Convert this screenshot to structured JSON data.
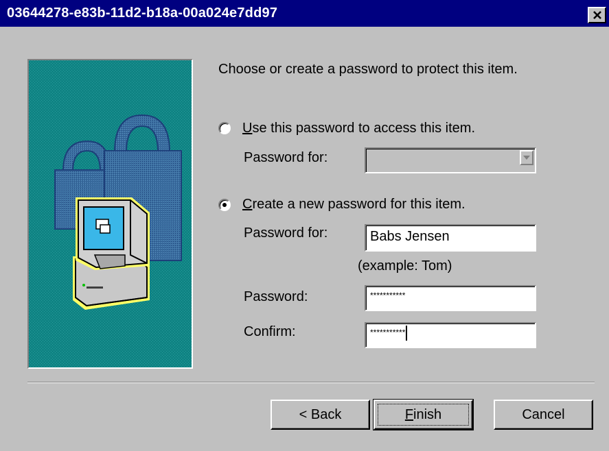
{
  "window": {
    "title": "03644278-e83b-11d2-b18a-00a024e7dd97",
    "close_glyph": "✕"
  },
  "instruction": "Choose or create a password to protect this item.",
  "option_use": {
    "label_key": "U",
    "label_rest": "se this password to access this item.",
    "selected": false,
    "password_for_label": "Password for:",
    "password_for_value": ""
  },
  "option_create": {
    "label_key": "C",
    "label_rest": "reate a new password for this item.",
    "selected": true,
    "password_for_label": "Password for:",
    "password_for_value": "Babs Jensen",
    "example_hint": "(example: Tom)",
    "password_label": "Password:",
    "password_value": "***********",
    "confirm_label": "Confirm:",
    "confirm_value": "***********"
  },
  "buttons": {
    "back_label": "< Back",
    "finish_key": "F",
    "finish_rest": "inish",
    "cancel_label": "Cancel"
  },
  "colors": {
    "title_bar": "#000080",
    "dialog_bg": "#c0c0c0",
    "side_panel": "#0f8383",
    "icon_highlight": "#ffff66"
  },
  "icons": [
    "close-icon",
    "padlock-icon",
    "computer-icon",
    "dropdown-arrow-icon"
  ]
}
